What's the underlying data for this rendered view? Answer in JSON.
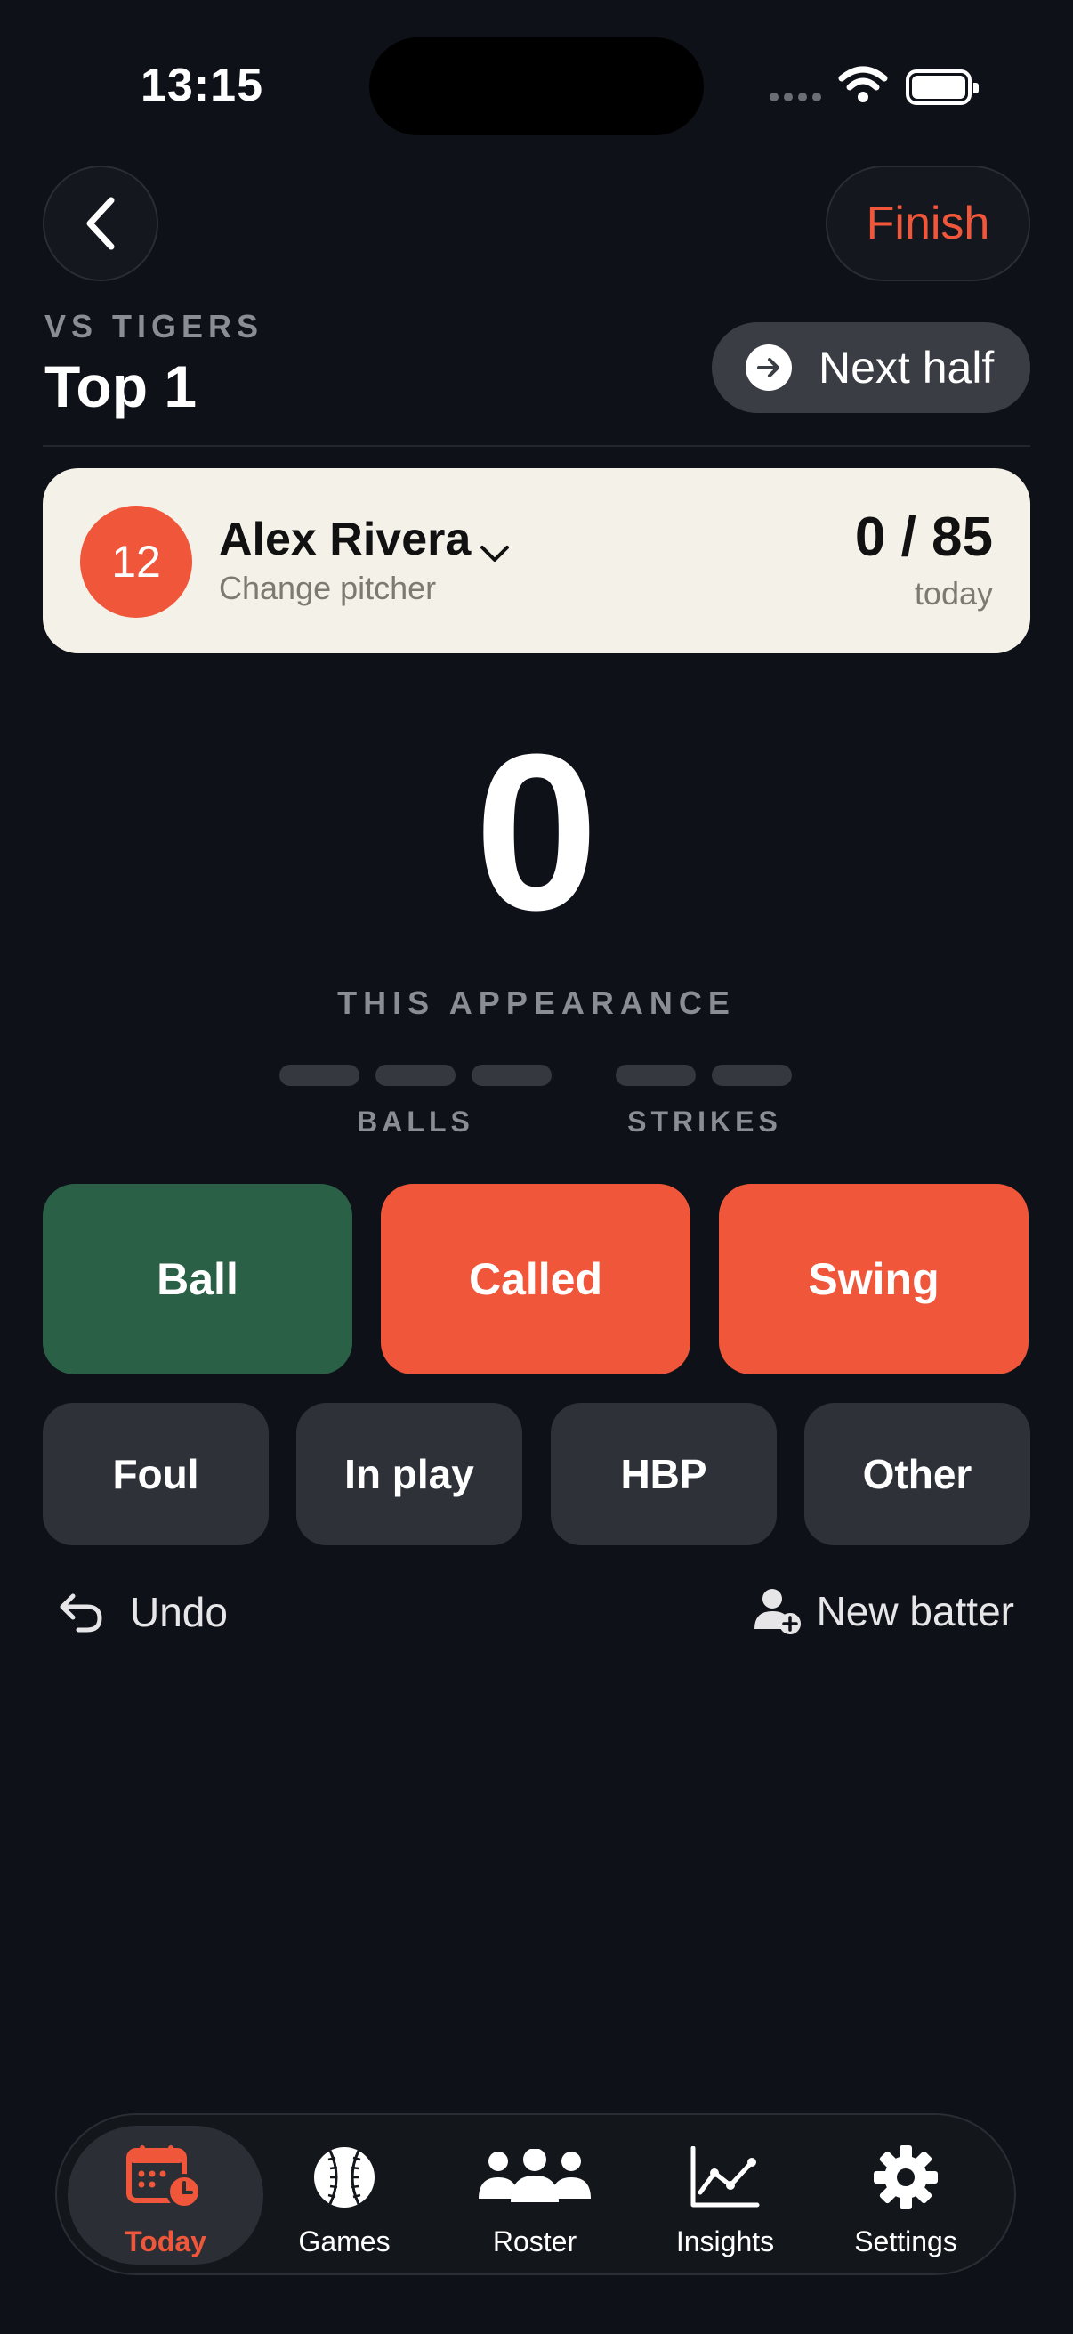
{
  "status_bar": {
    "time": "13:15"
  },
  "header": {
    "finish_label": "Finish",
    "opponent": "VS TIGERS",
    "inning": "Top 1",
    "next_half_label": "Next half"
  },
  "pitcher": {
    "number": "12",
    "name": "Alex Rivera",
    "subtitle": "Change pitcher",
    "pitch_count": "0 / 85",
    "count_caption": "today"
  },
  "appearance": {
    "pitch_count": "0",
    "label": "THIS APPEARANCE",
    "balls": 0,
    "balls_max": 3,
    "strikes": 0,
    "strikes_max": 2,
    "balls_label": "BALLS",
    "strikes_label": "STRIKES"
  },
  "actions": {
    "primary": [
      "Ball",
      "Called",
      "Swing"
    ],
    "secondary": [
      "Foul",
      "In play",
      "HBP",
      "Other"
    ],
    "undo_label": "Undo",
    "new_batter_label": "New batter"
  },
  "tabs": [
    {
      "label": "Today",
      "icon": "calendar-clock-icon",
      "active": true
    },
    {
      "label": "Games",
      "icon": "baseball-icon",
      "active": false
    },
    {
      "label": "Roster",
      "icon": "people-icon",
      "active": false
    },
    {
      "label": "Insights",
      "icon": "chart-line-icon",
      "active": false
    },
    {
      "label": "Settings",
      "icon": "gear-icon",
      "active": false
    }
  ],
  "colors": {
    "background": "#0e1117",
    "accent": "#f0563a",
    "ball_green": "#2a6045",
    "card": "#f4f1e8"
  }
}
